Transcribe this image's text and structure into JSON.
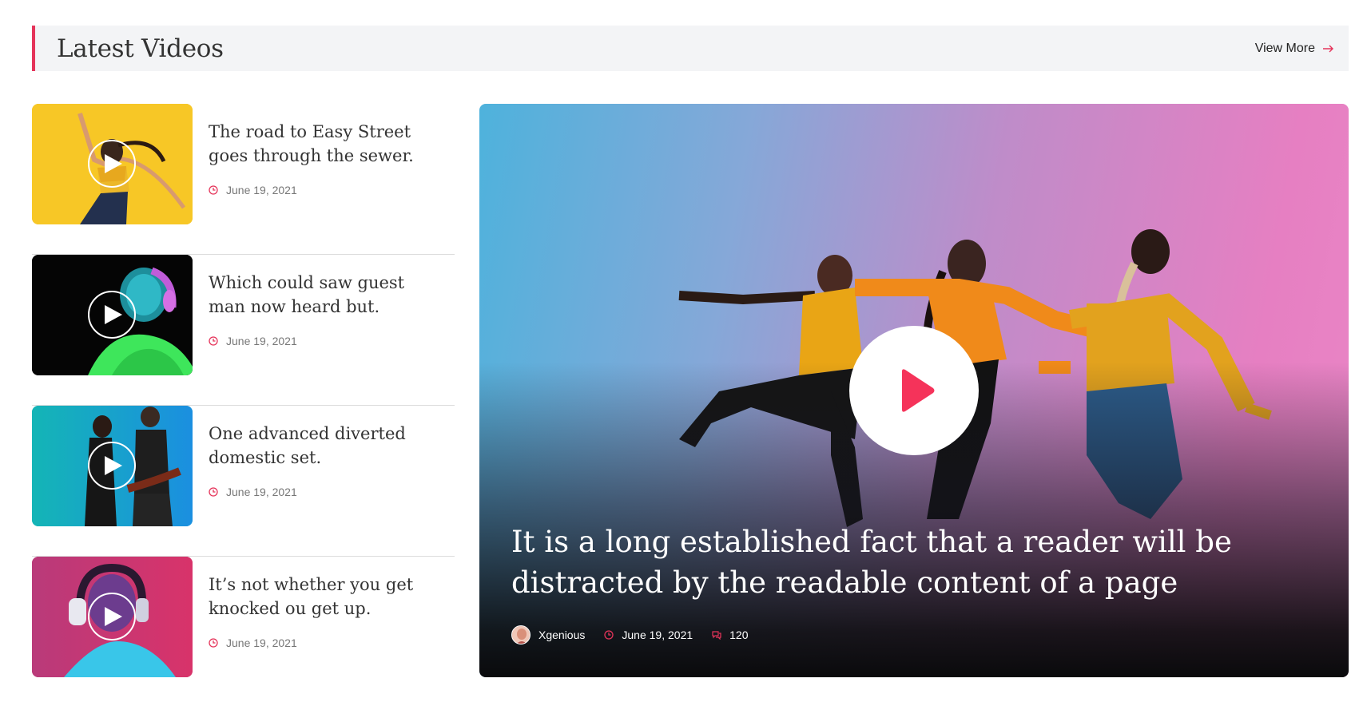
{
  "header": {
    "title": "Latest Videos",
    "view_more": "View More"
  },
  "list": [
    {
      "title": "The road to Easy Street goes through the sewer.",
      "date": "June 19, 2021",
      "icon": "play-icon"
    },
    {
      "title": "Which could saw guest man now heard but.",
      "date": "June 19, 2021",
      "icon": "play-icon"
    },
    {
      "title": "One advanced diverted domestic set.",
      "date": "June 19, 2021",
      "icon": "play-icon"
    },
    {
      "title": "It’s not whether you get knocked ou get up.",
      "date": "June 19, 2021",
      "icon": "play-icon"
    }
  ],
  "feature": {
    "title": "It is a long established fact that a reader will be distracted by the readable content of a page",
    "author": "Xgenious",
    "date": "June 19, 2021",
    "comments": "120"
  },
  "colors": {
    "accent": "#e5345a",
    "header_bg": "#f3f4f6"
  }
}
